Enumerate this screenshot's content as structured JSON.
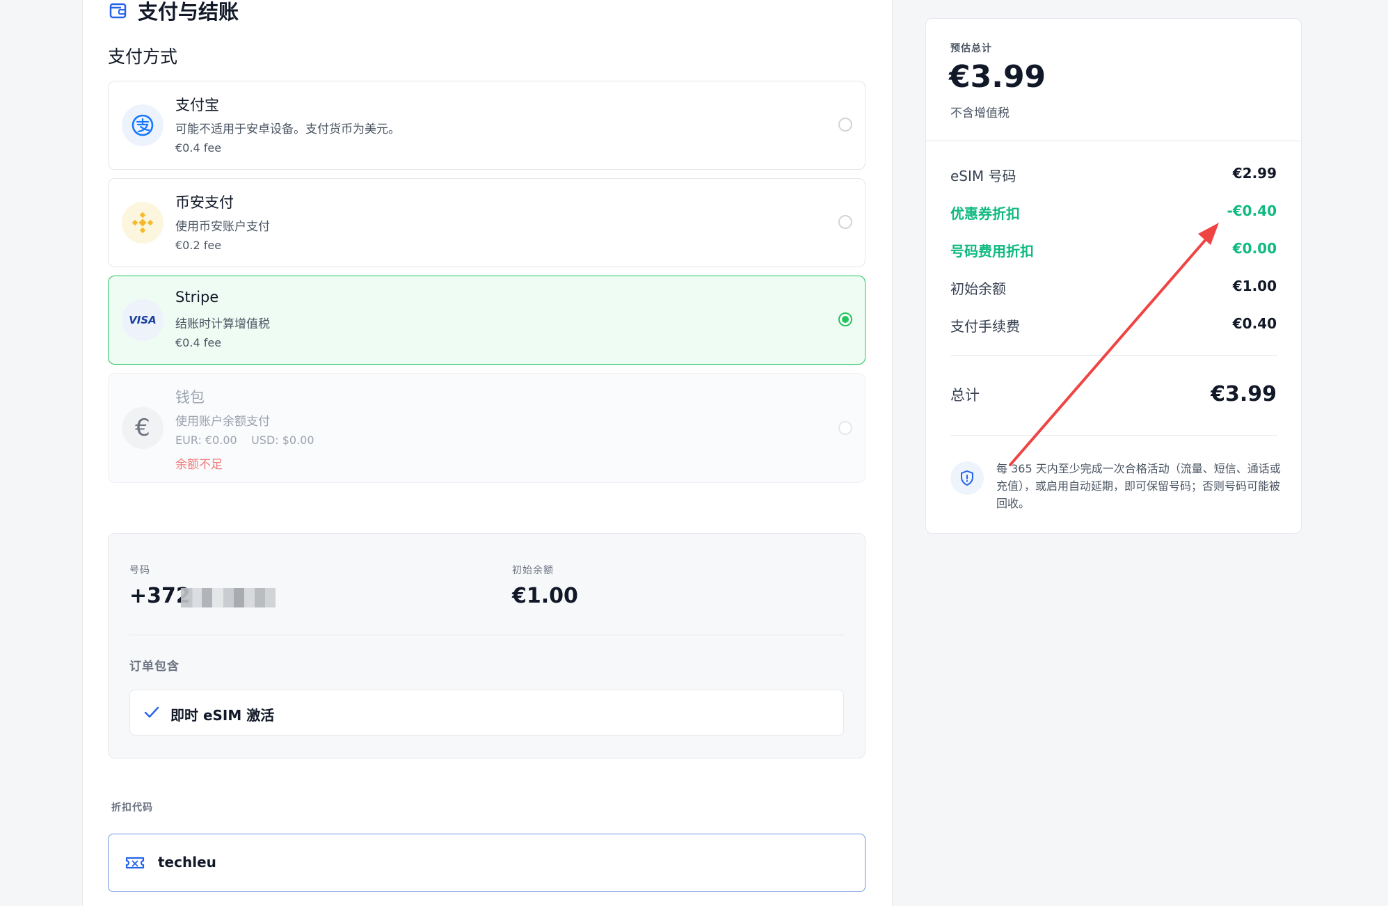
{
  "header": {
    "title": "支付与结账"
  },
  "payment": {
    "label": "支付方式",
    "methods": [
      {
        "name": "支付宝",
        "desc": "可能不适用于安卓设备。支付货币为美元。",
        "fee": "€0.4 fee",
        "icon": "alipay-icon"
      },
      {
        "name": "币安支付",
        "desc": "使用币安账户支付",
        "fee": "€0.2 fee",
        "icon": "binance-icon"
      },
      {
        "name": "Stripe",
        "desc": "结账时计算增值税",
        "fee": "€0.4 fee",
        "icon": "visa-icon",
        "icon_text": "VISA"
      },
      {
        "name": "钱包",
        "desc": "使用账户余额支付",
        "fee": "EUR: €0.00    USD: $0.00",
        "warning": "余额不足",
        "icon": "euro-icon",
        "icon_text": "€"
      }
    ],
    "selected": "Stripe"
  },
  "order": {
    "number_label": "号码",
    "number_prefix": "+372",
    "balance_label": "初始余额",
    "balance_value": "€1.00",
    "includes_label": "订单包含",
    "includes": [
      {
        "label": "即时 eSIM 激活"
      }
    ]
  },
  "coupon": {
    "label": "折扣代码",
    "value": "techleu"
  },
  "summary": {
    "est_label": "预估总计",
    "est_total": "€3.99",
    "vat_note": "不含增值税",
    "rows": [
      {
        "label": "eSIM 号码",
        "value": "€2.99"
      },
      {
        "label": "优惠券折扣",
        "value": "-€0.40"
      },
      {
        "label": "号码费用折扣",
        "value": "€0.00"
      },
      {
        "label": "初始余额",
        "value": "€1.00"
      },
      {
        "label": "支付手续费",
        "value": "€0.40"
      }
    ],
    "total_label": "总计",
    "total_value": "€3.99",
    "notice": "每 365 天内至少完成一次合格活动（流量、短信、通话或充值），或启用自动延期，即可保留号码；否则号码可能被回收。"
  },
  "colors": {
    "accent_green": "#22c55e",
    "discount_green": "#10b981",
    "link_blue": "#2563eb",
    "warning_red": "#f07d7d",
    "arrow_red": "#ef4444"
  }
}
